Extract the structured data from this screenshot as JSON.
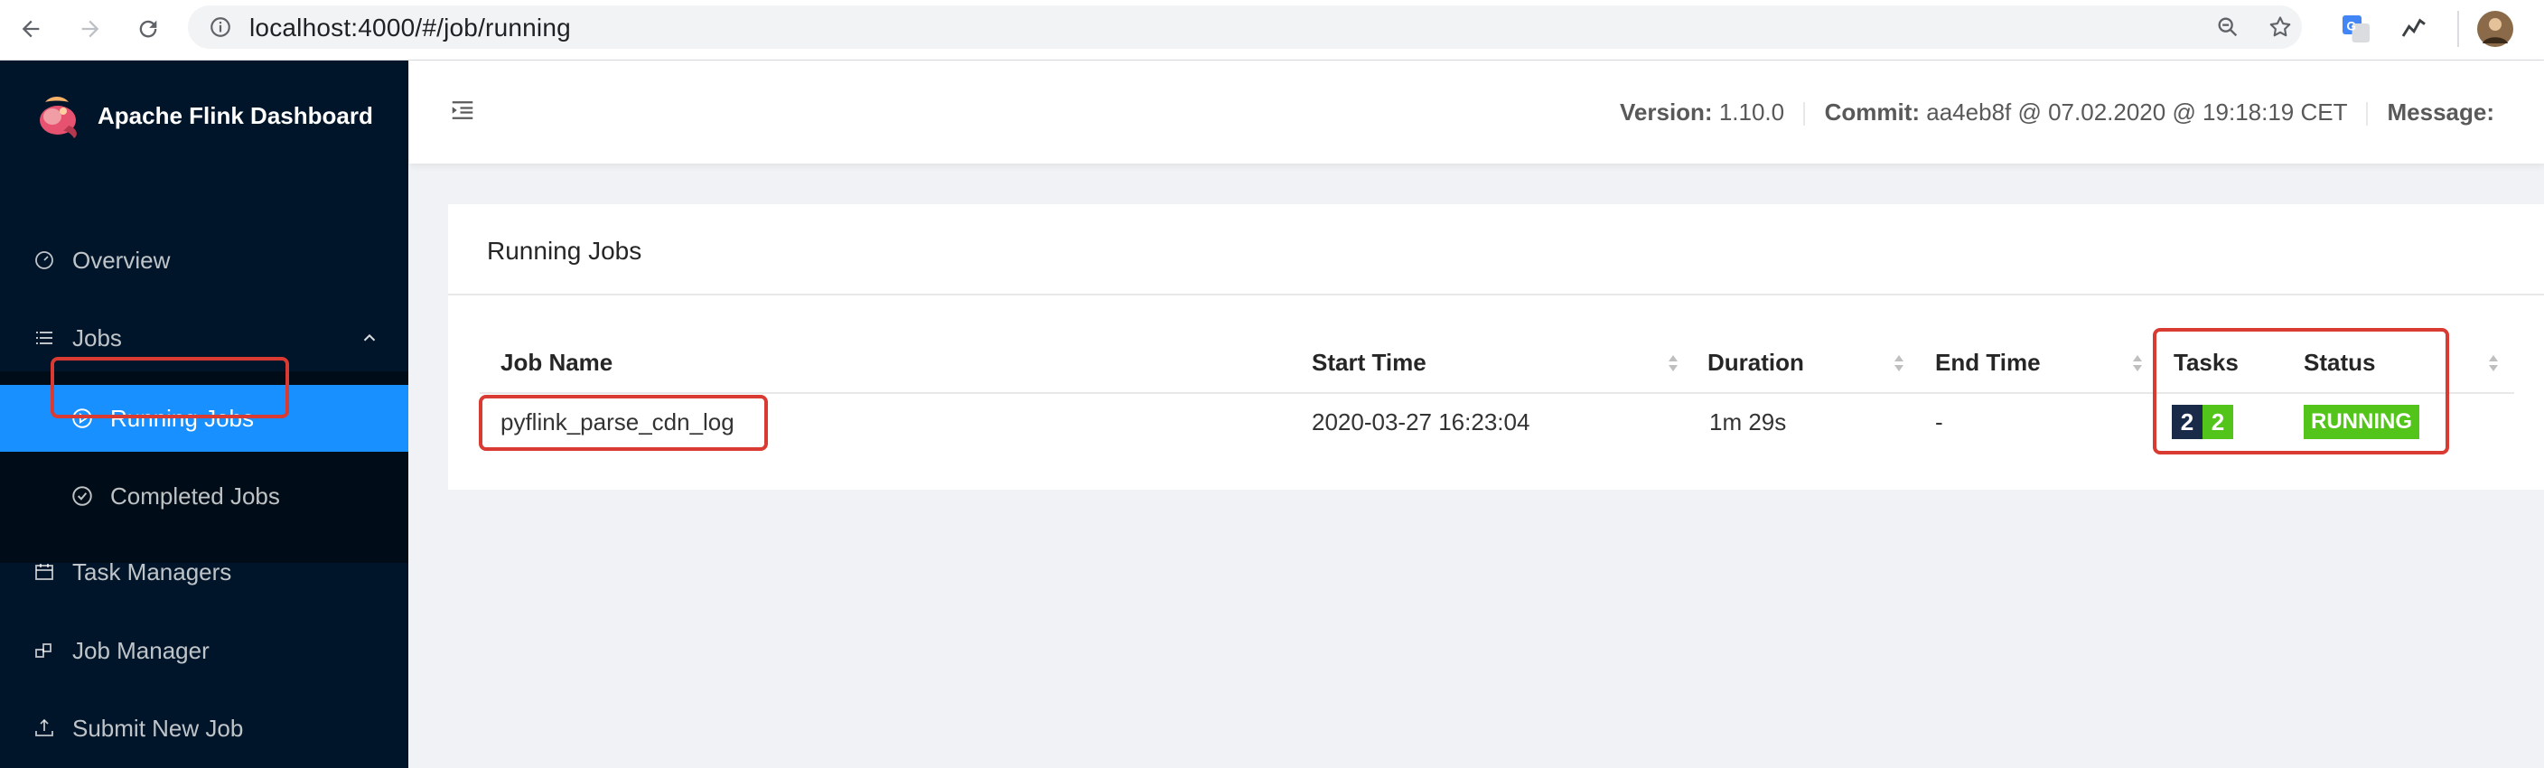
{
  "browser": {
    "url": "localhost:4000/#/job/running"
  },
  "sidebar": {
    "app_title": "Apache Flink Dashboard",
    "items": [
      {
        "label": "Overview"
      },
      {
        "label": "Jobs"
      },
      {
        "label": "Running Jobs",
        "selected": true
      },
      {
        "label": "Completed Jobs"
      },
      {
        "label": "Task Managers"
      },
      {
        "label": "Job Manager"
      },
      {
        "label": "Submit New Job"
      }
    ]
  },
  "header": {
    "version_label": "Version:",
    "version_value": "1.10.0",
    "commit_label": "Commit:",
    "commit_value": "aa4eb8f @ 07.02.2020 @ 19:18:19 CET",
    "message_label": "Message:"
  },
  "card": {
    "title": "Running Jobs",
    "columns": [
      "Job Name",
      "Start Time",
      "Duration",
      "End Time",
      "Tasks",
      "Status"
    ],
    "rows": [
      {
        "job_name": "pyflink_parse_cdn_log",
        "start_time": "2020-03-27 16:23:04",
        "duration": "1m 29s",
        "end_time": "-",
        "tasks": [
          "2",
          "2"
        ],
        "status": "RUNNING"
      }
    ]
  },
  "colors": {
    "sidebar_bg": "#001529",
    "selected_bg": "#1890ff",
    "running_green": "#52c41a",
    "task_dark": "#1a2b4a",
    "highlight_red": "#d93a31"
  }
}
